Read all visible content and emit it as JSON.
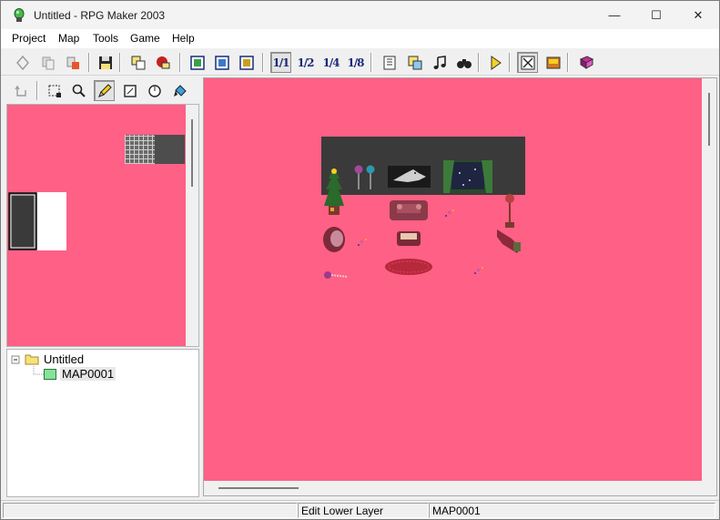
{
  "window": {
    "title": "Untitled - RPG Maker 2003",
    "min_glyph": "—",
    "max_glyph": "☐",
    "close_glyph": "✕"
  },
  "menu": [
    "Project",
    "Map",
    "Tools",
    "Game",
    "Help"
  ],
  "toolbar": {
    "zoom_labels": [
      "1/1",
      "1/2",
      "1/4",
      "1/8"
    ]
  },
  "tree": {
    "root": "Untitled",
    "maps": [
      "MAP0001"
    ]
  },
  "status": {
    "mode": "Edit Lower Layer",
    "map": "MAP0001"
  },
  "colors": {
    "canvas": "#ff6085",
    "wall": "#3a3a3a",
    "tree_folder": "#f5e27a",
    "map_icon": "#86e39a"
  }
}
